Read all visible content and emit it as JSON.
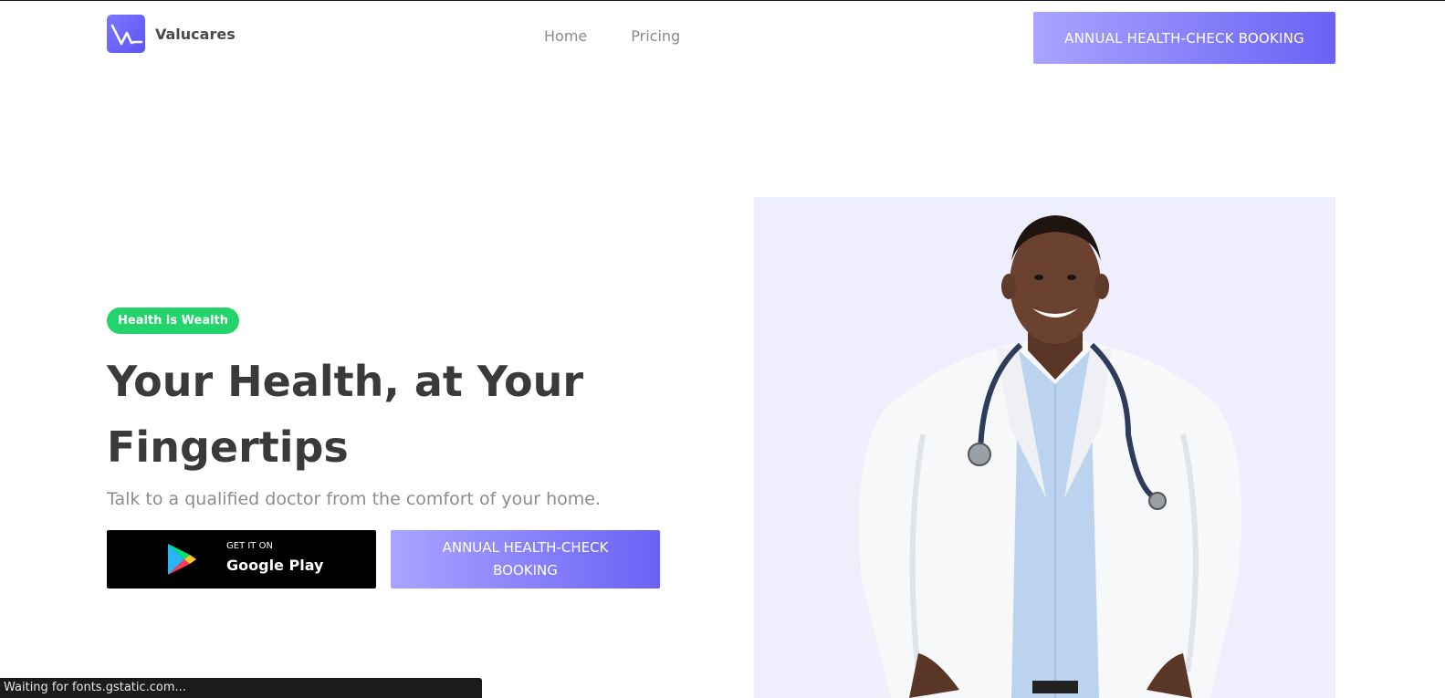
{
  "header": {
    "brand": "Valucares",
    "nav": [
      "Home",
      "Pricing"
    ],
    "cta_label": "ANNUAL HEALTH-CHECK BOOKING"
  },
  "hero": {
    "badge": "Health is Wealth",
    "headline": "Your Health, at Your Fingertips",
    "subtext": "Talk to a qualified doctor from the comfort of your home.",
    "store_button": {
      "small": "GET IT ON",
      "big": "Google Play"
    },
    "cta_label": "ANNUAL HEALTH-CHECK BOOKING"
  },
  "status_bar": {
    "text": "Waiting for fonts.gstatic.com..."
  },
  "colors": {
    "brand": "#6a62f5",
    "badge_green": "#22d46a",
    "photo_background": "#eeeefc"
  }
}
